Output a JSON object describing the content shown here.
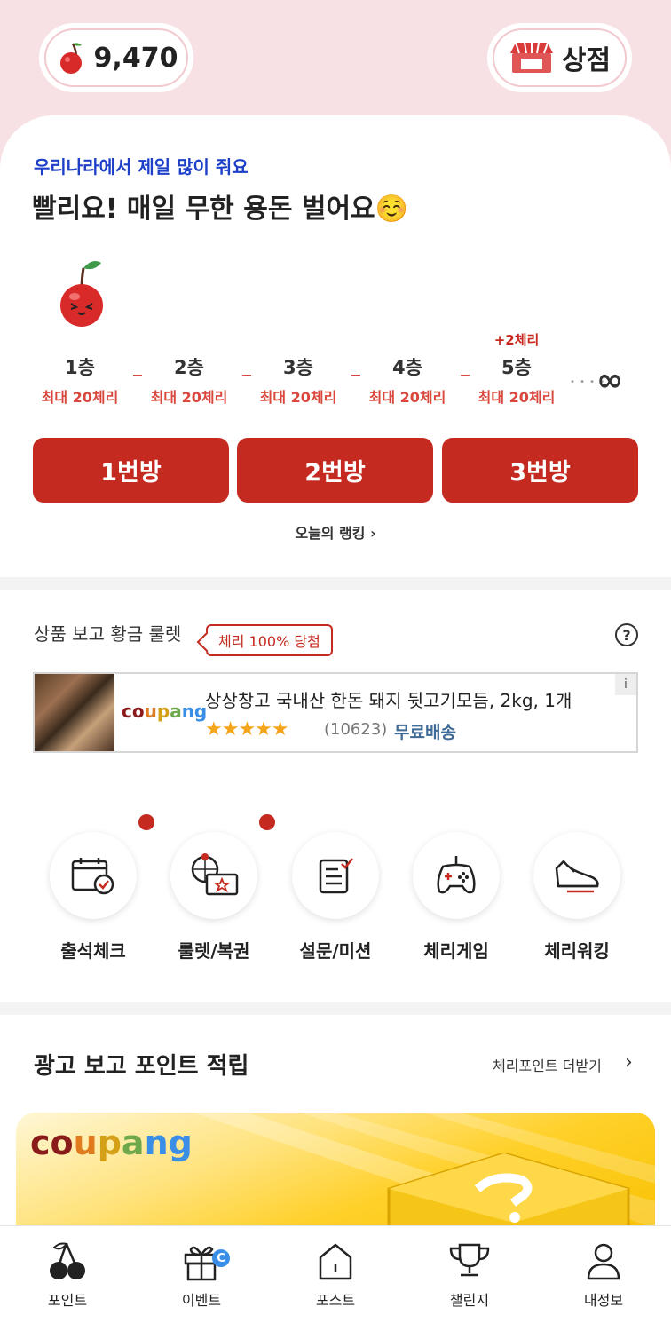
{
  "header": {
    "points": "9,470",
    "shop_label": "상점"
  },
  "main": {
    "subtitle": "우리나라에서 제일 많이 줘요",
    "headline": "빨리요! 매일 무한 용돈 벌어요☺️",
    "floors": [
      {
        "label": "1층",
        "max": "최대 20체리",
        "bonus": ""
      },
      {
        "label": "2층",
        "max": "최대 20체리",
        "bonus": ""
      },
      {
        "label": "3층",
        "max": "최대 20체리",
        "bonus": ""
      },
      {
        "label": "4층",
        "max": "최대 20체리",
        "bonus": ""
      },
      {
        "label": "5층",
        "max": "최대 20체리",
        "bonus": "+2체리"
      }
    ],
    "infinity": "∞",
    "rooms": [
      "1번방",
      "2번방",
      "3번방"
    ],
    "ranking_link": "오늘의 랭킹 ›"
  },
  "roulette": {
    "title": "상품 보고 황금 룰렛",
    "badge": "체리 100% 당첨",
    "help": "?",
    "ad": {
      "logo": "coupang",
      "title": "상상창고 국내산 한돈 돼지 뒷고기모듬, 2kg, 1개",
      "stars": "★★★★★",
      "rating_count": "(10623)",
      "delivery": "무료배송",
      "info": "i"
    }
  },
  "quick_menu": [
    {
      "label": "출석체크",
      "icon": "calendar-check-icon",
      "dot": true
    },
    {
      "label": "룰렛/복권",
      "icon": "roulette-ticket-icon",
      "dot": true
    },
    {
      "label": "설문/미션",
      "icon": "survey-icon",
      "dot": false
    },
    {
      "label": "체리게임",
      "icon": "gamepad-icon",
      "dot": false
    },
    {
      "label": "체리워킹",
      "icon": "sneaker-icon",
      "dot": false
    }
  ],
  "ad_points": {
    "title": "광고 보고 포인트 적립",
    "more_label": "체리포인트 더받기",
    "chevron": "›",
    "banner_logo": "coupang"
  },
  "bottom_nav": [
    {
      "label": "포인트",
      "icon": "cherry-icon"
    },
    {
      "label": "이벤트",
      "icon": "gift-icon",
      "badge": "C"
    },
    {
      "label": "포스트",
      "icon": "home-icon"
    },
    {
      "label": "챌린지",
      "icon": "trophy-icon"
    },
    {
      "label": "내정보",
      "icon": "person-icon"
    }
  ],
  "colors": {
    "brand_red": "#c42a20",
    "top_pink": "#f8e1e5",
    "subtitle_blue": "#1e40c8"
  }
}
